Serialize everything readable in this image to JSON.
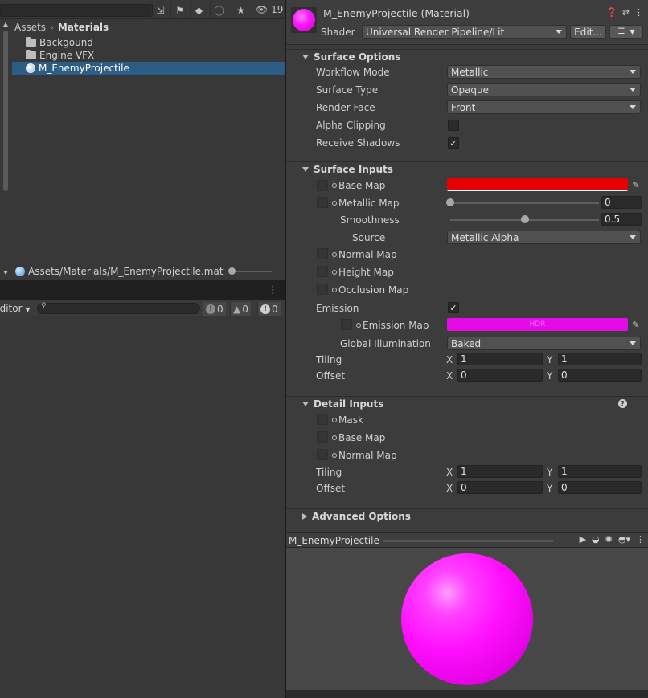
{
  "project": {
    "toolbar": {
      "hidden_count": "19"
    },
    "breadcrumb": [
      "Assets",
      "Materials"
    ],
    "items": [
      {
        "name": "Backgound",
        "type": "folder"
      },
      {
        "name": "Engine VFX",
        "type": "folder"
      },
      {
        "name": "M_EnemyProjectile",
        "type": "material",
        "selected": true
      }
    ],
    "path": "Assets/Materials/M_EnemyProjectile.mat"
  },
  "console": {
    "dropdown": "Editor",
    "errors": "0",
    "warnings": "0",
    "infos": "0"
  },
  "inspector": {
    "title": "M_EnemyProjectile (Material)",
    "shader_label": "Shader",
    "shader_value": "Universal Render Pipeline/Lit",
    "edit_button": "Edit...",
    "surface_options": {
      "title": "Surface Options",
      "workflow_mode_label": "Workflow Mode",
      "workflow_mode_value": "Metallic",
      "surface_type_label": "Surface Type",
      "surface_type_value": "Opaque",
      "render_face_label": "Render Face",
      "render_face_value": "Front",
      "alpha_clipping_label": "Alpha Clipping",
      "alpha_clipping": false,
      "receive_shadows_label": "Receive Shadows",
      "receive_shadows": true
    },
    "surface_inputs": {
      "title": "Surface Inputs",
      "base_map_label": "Base Map",
      "base_map_color": "#e60000",
      "metallic_map_label": "Metallic Map",
      "metallic_value": "0",
      "metallic_fraction": 0,
      "smoothness_label": "Smoothness",
      "smoothness_value": "0.5",
      "smoothness_fraction": 0.5,
      "source_label": "Source",
      "source_value": "Metallic Alpha",
      "normal_map_label": "Normal Map",
      "height_map_label": "Height Map",
      "occlusion_map_label": "Occlusion Map",
      "emission_label": "Emission",
      "emission": true,
      "emission_map_label": "Emission Map",
      "emission_color": "#e60be6",
      "emission_hdr_text": "HDR",
      "global_illumination_label": "Global Illumination",
      "global_illumination_value": "Baked",
      "tiling_label": "Tiling",
      "tiling_x": "1",
      "tiling_y": "1",
      "offset_label": "Offset",
      "offset_x": "0",
      "offset_y": "0"
    },
    "detail_inputs": {
      "title": "Detail Inputs",
      "mask_label": "Mask",
      "base_map_label": "Base Map",
      "normal_map_label": "Normal Map",
      "tiling_label": "Tiling",
      "tiling_x": "1",
      "tiling_y": "1",
      "offset_label": "Offset",
      "offset_x": "0",
      "offset_y": "0"
    },
    "advanced_options": {
      "title": "Advanced Options"
    },
    "preview": {
      "title": "M_EnemyProjectile",
      "ball_color": "#ff10ff"
    },
    "axis_x": "X",
    "axis_y": "Y"
  }
}
